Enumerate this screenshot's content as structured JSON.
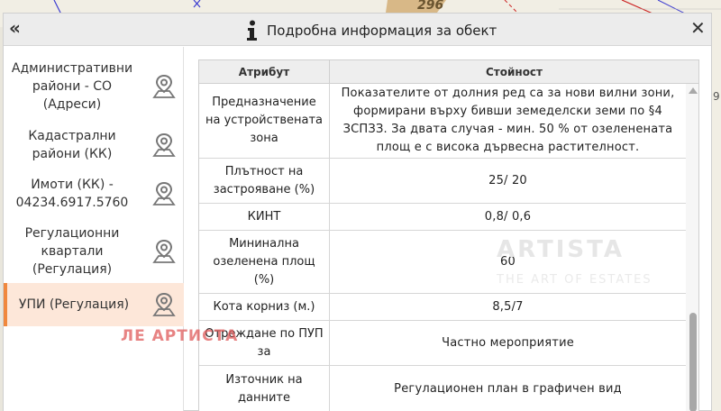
{
  "map": {
    "label": "296",
    "right_label": "9"
  },
  "header": {
    "collapse_symbol": "«",
    "title": "Подробна информация за обект",
    "close_symbol": "✕"
  },
  "sidebar": {
    "items": [
      {
        "label": "Административни райони - СО (Адреси)",
        "active": false
      },
      {
        "label": "Кадастрални райони (КК)",
        "active": false
      },
      {
        "label": "Имоти (КК) - 04234.6917.5760",
        "active": false
      },
      {
        "label": "Регулационни квартали (Регулация)",
        "active": false
      },
      {
        "label": "УПИ (Регулация)",
        "active": true
      }
    ]
  },
  "watermark": {
    "red": "ЛЕ АРТИСТА",
    "center": "ARTISTA",
    "center_sub": "THE ART OF ESTATES"
  },
  "table": {
    "headers": {
      "attribute": "Атрибут",
      "value": "Стойност"
    },
    "rows": [
      {
        "attribute": "Предназначение на устройствената зона",
        "value": "Показателите от долния ред са за нови вилни зони, формирани върху бивши земеделски земи по §4 ЗСПЗЗ. За двата случая - мин. 50 % от озеленената площ е с висока дървесна растителност."
      },
      {
        "attribute": "Плътност на застрояване (%)",
        "value": "25/ 20"
      },
      {
        "attribute": "КИНТ",
        "value": "0,8/ 0,6"
      },
      {
        "attribute": "Мининална озеленена площ (%)",
        "value": "60"
      },
      {
        "attribute": "Кота корниз (м.)",
        "value": "8,5/7"
      },
      {
        "attribute": "Отреждане по ПУП за",
        "value": "Частно мероприятие"
      },
      {
        "attribute": "Източник на данните",
        "value": "Регулационен план в графичен вид"
      }
    ]
  },
  "colors": {
    "active_bg": "#fde7d9",
    "active_border": "#f0883e",
    "header_bg": "#ececec"
  }
}
